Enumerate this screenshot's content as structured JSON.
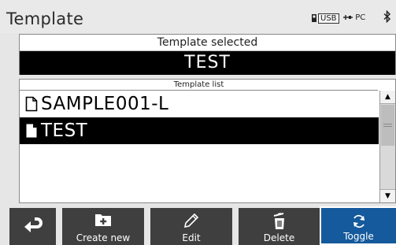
{
  "header": {
    "title": "Template",
    "usb_label": "USB",
    "pc_label": "PC"
  },
  "selected_panel": {
    "header": "Template selected",
    "value": "TEST"
  },
  "template_list": {
    "header": "Template list",
    "items": [
      {
        "label": "SAMPLE001-L",
        "selected": false
      },
      {
        "label": "TEST",
        "selected": true
      }
    ]
  },
  "toolbar": {
    "create_label": "Create new",
    "edit_label": "Edit",
    "delete_label": "Delete",
    "toggle_label": "Toggle"
  },
  "colors": {
    "toolbar_button": "#3f3f3f",
    "toggle_active": "#155a9c",
    "selection": "#000000"
  },
  "icons": [
    "usb-icon",
    "pc-connection-icon",
    "bluetooth-icon",
    "file-icon",
    "back-icon",
    "folder-plus-icon",
    "pencil-icon",
    "trash-icon",
    "refresh-icon"
  ]
}
